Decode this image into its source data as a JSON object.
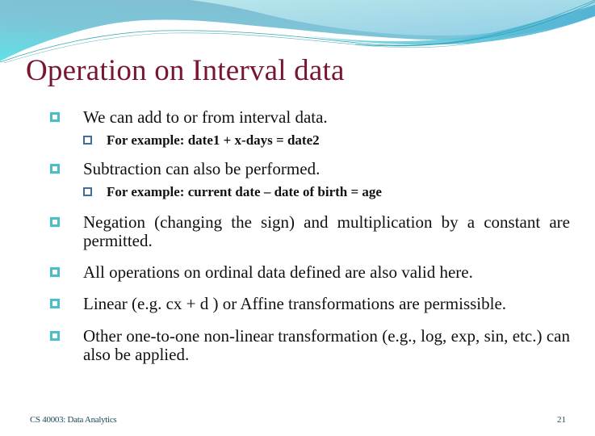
{
  "slide": {
    "title": "Operation on Interval data",
    "bullets": [
      {
        "text": "We can add to or from interval data.",
        "sub": "For example:  date1 + x-days = date2"
      },
      {
        "text": "Subtraction can also be performed.",
        "sub": "For example: current date – date of birth = age"
      },
      {
        "text": "Negation (changing the sign) and multiplication by a constant are permitted."
      },
      {
        "text": "All operations on ordinal data defined are also valid here."
      },
      {
        "text": "Linear (e.g. cx + d ) or Affine transformations are permissible."
      },
      {
        "text": "Other one-to-one non-linear transformation (e.g., log, exp, sin, etc.) can also be applied."
      }
    ],
    "bullet_icon": "square-bullet-icon",
    "sub_bullet_icon": "square-sub-bullet-icon"
  },
  "footer": {
    "course": "CS 40003: Data Analytics",
    "page_number": "21"
  },
  "colors": {
    "title": "#7a1530",
    "bullet": "#4fbec4",
    "sub_bullet": "#3d6f9a",
    "header_wave_dark": "#7fbcd4",
    "header_wave_light": "#a9dfe6",
    "header_wave_cyan": "#5fd8e0",
    "footer_text": "#1c4a5a"
  }
}
